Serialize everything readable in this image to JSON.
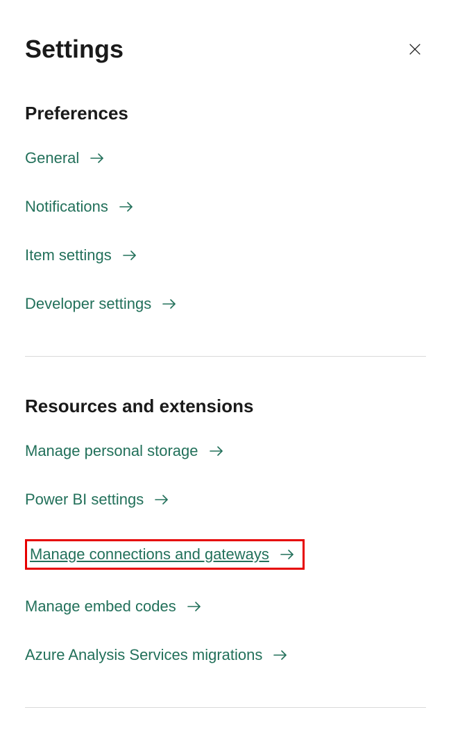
{
  "header": {
    "title": "Settings"
  },
  "sections": {
    "preferences": {
      "title": "Preferences",
      "items": [
        {
          "label": "General"
        },
        {
          "label": "Notifications"
        },
        {
          "label": "Item settings"
        },
        {
          "label": "Developer settings"
        }
      ]
    },
    "resources": {
      "title": "Resources and extensions",
      "items": [
        {
          "label": "Manage personal storage"
        },
        {
          "label": "Power BI settings"
        },
        {
          "label": "Manage connections and gateways"
        },
        {
          "label": "Manage embed codes"
        },
        {
          "label": "Azure Analysis Services migrations"
        }
      ]
    }
  }
}
